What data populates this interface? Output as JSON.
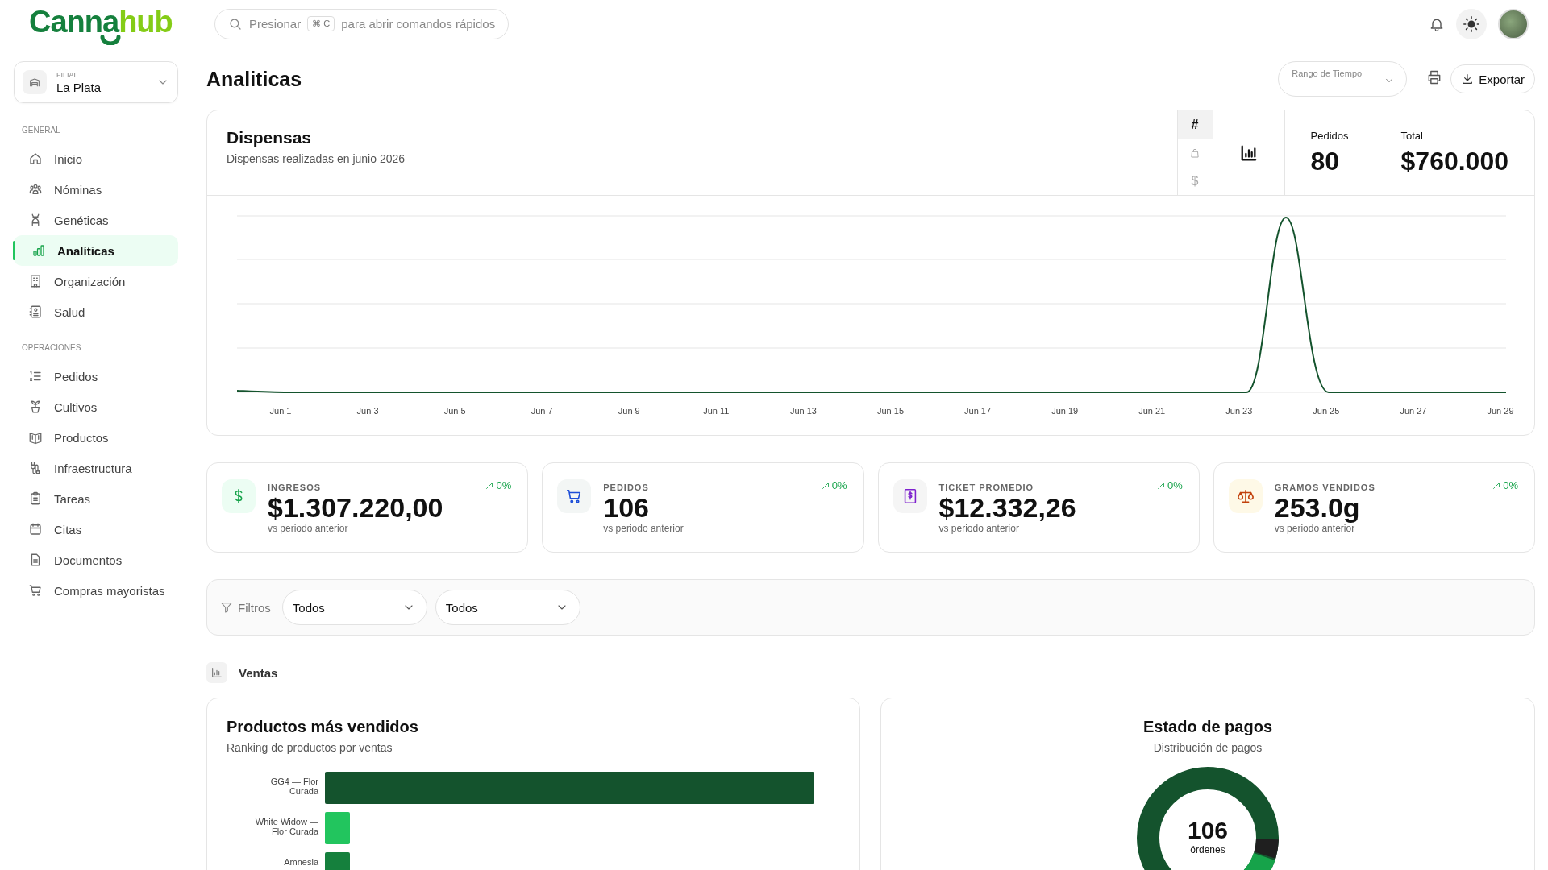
{
  "app": {
    "logo_primary": "Canna",
    "logo_secondary": "hub"
  },
  "search": {
    "before_key": "Presionar",
    "key": "⌘ C",
    "after_key": "para abrir comandos rápidos"
  },
  "branch": {
    "label": "FILIAL",
    "value": "La Plata"
  },
  "sidebar": {
    "sections": [
      {
        "title": "GENERAL",
        "items": [
          {
            "label": "Inicio",
            "selected": false
          },
          {
            "label": "Nóminas",
            "selected": false
          },
          {
            "label": "Genéticas",
            "selected": false
          },
          {
            "label": "Analíticas",
            "selected": true
          },
          {
            "label": "Organización",
            "selected": false
          },
          {
            "label": "Salud",
            "selected": false
          }
        ]
      },
      {
        "title": "OPERACIONES",
        "items": [
          {
            "label": "Pedidos",
            "selected": false
          },
          {
            "label": "Cultivos",
            "selected": false
          },
          {
            "label": "Productos",
            "selected": false
          },
          {
            "label": "Infraestructura",
            "selected": false
          },
          {
            "label": "Tareas",
            "selected": false
          },
          {
            "label": "Citas",
            "selected": false
          },
          {
            "label": "Documentos",
            "selected": false
          },
          {
            "label": "Compras mayoristas",
            "selected": false
          }
        ]
      }
    ]
  },
  "page": {
    "title": "Analiticas",
    "time_range": {
      "placeholder": "Rango de Tiempo"
    },
    "export_label": "Exportar"
  },
  "dispensas": {
    "title": "Dispensas",
    "subtitle": "Dispensas realizadas en junio 2026",
    "modes": [
      {
        "kind": "count",
        "label": "#",
        "selected": true
      },
      {
        "kind": "bag",
        "selected": false
      },
      {
        "kind": "money",
        "label": "$",
        "selected": false
      }
    ],
    "stats": [
      {
        "label": "Pedidos",
        "value": "80"
      },
      {
        "label": "Total",
        "value": "$760.000"
      }
    ],
    "x_labels": [
      "Jun 1",
      "Jun 3",
      "Jun 5",
      "Jun 7",
      "Jun 9",
      "Jun 11",
      "Jun 13",
      "Jun 15",
      "Jun 17",
      "Jun 19",
      "Jun 21",
      "Jun 23",
      "Jun 25",
      "Jun 27",
      "Jun 29"
    ]
  },
  "kpis": [
    {
      "kind": "revenue",
      "label": "INGRESOS",
      "value": "$1.307.220,00",
      "trend": "0%",
      "caption": "vs periodo anterior"
    },
    {
      "kind": "orders",
      "label": "PEDIDOS",
      "value": "106",
      "trend": "0%",
      "caption": "vs periodo anterior"
    },
    {
      "kind": "ticket",
      "label": "TICKET PROMEDIO",
      "value": "$12.332,26",
      "trend": "0%",
      "caption": "vs periodo anterior"
    },
    {
      "kind": "grams",
      "label": "GRAMOS VENDIDOS",
      "value": "253.0g",
      "trend": "0%",
      "caption": "vs periodo anterior"
    }
  ],
  "filters": {
    "label": "Filtros",
    "selects": [
      {
        "value": "Todos"
      },
      {
        "value": "Todos"
      }
    ]
  },
  "section": {
    "title": "Ventas"
  },
  "top_products": {
    "title": "Productos más vendidos",
    "subtitle": "Ranking de productos por ventas",
    "bars": [
      {
        "label": "GG4 — Flor Curada"
      },
      {
        "label": "White Widow — Flor Curada"
      },
      {
        "label": "Amnesia"
      }
    ]
  },
  "payments": {
    "title": "Estado de pagos",
    "subtitle": "Distribución de pagos",
    "total": "106",
    "total_label": "órdenes"
  }
}
